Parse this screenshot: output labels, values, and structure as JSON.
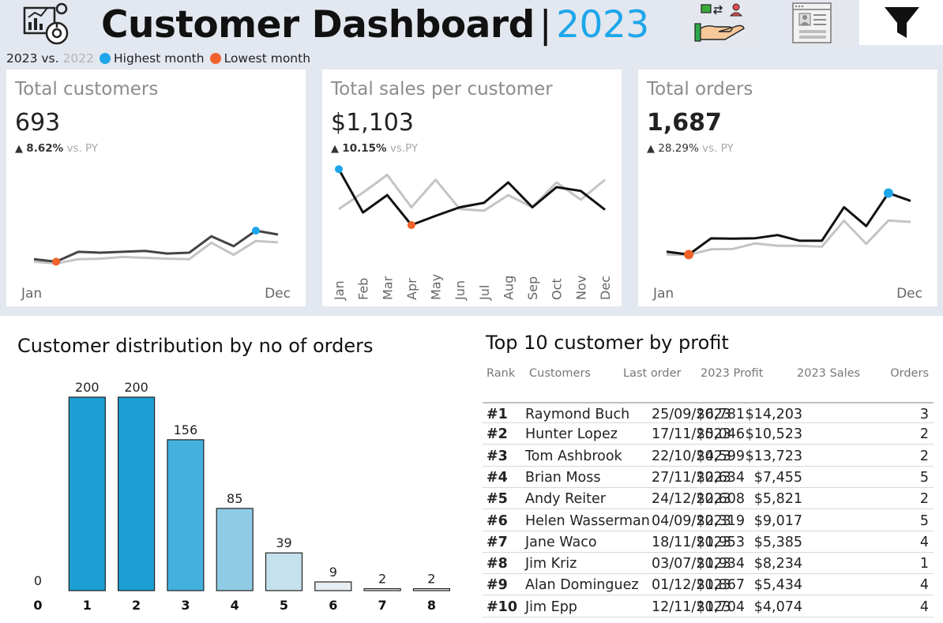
{
  "header": {
    "title": "Customer Dashboard",
    "separator": "|",
    "year": "2023",
    "icons": [
      "dashboard-analytics-icon",
      "customer-exchange-icon",
      "document-view-icon",
      "filter-icon"
    ]
  },
  "legend": {
    "current_year": "2023 vs.",
    "prior_year": "2022",
    "highest_label": "Highest month",
    "lowest_label": "Lowest month",
    "highest_color": "#1ea6ea",
    "lowest_color": "#f0622a"
  },
  "kpis": [
    {
      "label": "Total customers",
      "value": "693",
      "change": "8.62%",
      "vs": "vs. PY",
      "x_start": "Jan",
      "x_end": "Dec"
    },
    {
      "label": "Total sales per customer",
      "value": "$1,103",
      "change": "10.15%",
      "vs": "vs.PY"
    },
    {
      "label": "Total orders",
      "value": "1,687",
      "change": "28.29%",
      "vs": "vs. PY",
      "x_start": "Jan",
      "x_end": "Dec"
    }
  ],
  "chart_data": [
    {
      "type": "line",
      "title": "Total customers",
      "x": [
        "Jan",
        "Feb",
        "Mar",
        "Apr",
        "May",
        "Jun",
        "Jul",
        "Aug",
        "Sep",
        "Oct",
        "Nov",
        "Dec"
      ],
      "series": [
        {
          "name": "2023",
          "values": [
            40,
            34,
            57,
            55,
            57,
            59,
            53,
            55,
            93,
            70,
            106,
            97
          ]
        },
        {
          "name": "2022",
          "values": [
            34,
            30,
            40,
            41,
            45,
            43,
            41,
            40,
            78,
            50,
            82,
            79
          ]
        }
      ],
      "highest_index": 10,
      "lowest_index": 1,
      "ylim": [
        0,
        260
      ]
    },
    {
      "type": "line",
      "title": "Total sales per customer",
      "x": [
        "Jan",
        "Feb",
        "Mar",
        "Apr",
        "May",
        "Jun",
        "Jul",
        "Aug",
        "Sep",
        "Oct",
        "Nov",
        "Dec"
      ],
      "series": [
        {
          "name": "2023",
          "values": [
            1583,
            1134,
            1314,
            1003,
            1098,
            1188,
            1234,
            1446,
            1188,
            1397,
            1357,
            1162
          ]
        },
        {
          "name": "2022",
          "values": [
            1170,
            1340,
            1524,
            1188,
            1474,
            1170,
            1152,
            1314,
            1188,
            1446,
            1266,
            1474
          ]
        }
      ],
      "highest_index": 0,
      "lowest_index": 3,
      "ylim": [
        700,
        1700
      ]
    },
    {
      "type": "line",
      "title": "Total orders",
      "x": [
        "Jan",
        "Feb",
        "Mar",
        "Apr",
        "May",
        "Jun",
        "Jul",
        "Aug",
        "Sep",
        "Oct",
        "Nov",
        "Dec"
      ],
      "series": [
        {
          "name": "2023",
          "values": [
            54,
            35,
            143,
            141,
            144,
            165,
            127,
            127,
            351,
            225,
            445,
            393
          ]
        },
        {
          "name": "2022",
          "values": [
            35,
            33,
            70,
            73,
            110,
            94,
            94,
            88,
            261,
            106,
            262,
            253
          ]
        }
      ],
      "highest_index": 10,
      "lowest_index": 1,
      "ylim": [
        -110,
        700
      ]
    },
    {
      "type": "bar",
      "title": "Customer distribution by no of orders",
      "categories": [
        "0",
        "1",
        "2",
        "3",
        "4",
        "5",
        "6",
        "7",
        "8"
      ],
      "values": [
        0,
        200,
        200,
        156,
        85,
        39,
        9,
        2,
        2
      ],
      "ylim": [
        0,
        200
      ]
    }
  ],
  "table": {
    "title": "Top 10 customer by profit",
    "columns": [
      "Rank",
      "Customers",
      "Last order",
      "2023 Profit",
      "2023 Sales",
      "Orders"
    ],
    "rows": [
      {
        "rank": "#1",
        "name": "Raymond Buch",
        "last_order": "25/09/2023",
        "profit": "$6,781",
        "sales": "$14,203",
        "orders": "3"
      },
      {
        "rank": "#2",
        "name": "Hunter Lopez",
        "last_order": "17/11/2023",
        "profit": "$5,046",
        "sales": "$10,523",
        "orders": "2"
      },
      {
        "rank": "#3",
        "name": "Tom Ashbrook",
        "last_order": "22/10/2023",
        "profit": "$4,599",
        "sales": "$13,723",
        "orders": "2"
      },
      {
        "rank": "#4",
        "name": "Brian Moss",
        "last_order": "27/11/2023",
        "profit": "$2,634",
        "sales": "$7,455",
        "orders": "5"
      },
      {
        "rank": "#5",
        "name": "Andy Reiter",
        "last_order": "24/12/2023",
        "profit": "$2,608",
        "sales": "$5,821",
        "orders": "2"
      },
      {
        "rank": "#6",
        "name": "Helen Wasserman",
        "last_order": "04/09/2023",
        "profit": "$2,319",
        "sales": "$9,017",
        "orders": "5"
      },
      {
        "rank": "#7",
        "name": "Jane Waco",
        "last_order": "18/11/2023",
        "profit": "$1,953",
        "sales": "$5,385",
        "orders": "4"
      },
      {
        "rank": "#8",
        "name": "Jim Kriz",
        "last_order": "03/07/2023",
        "profit": "$1,934",
        "sales": "$8,234",
        "orders": "1"
      },
      {
        "rank": "#9",
        "name": "Alan Dominguez",
        "last_order": "01/12/2023",
        "profit": "$1,867",
        "sales": "$5,434",
        "orders": "4"
      },
      {
        "rank": "#10",
        "name": "Jim Epp",
        "last_order": "12/11/2023",
        "profit": "$1,704",
        "sales": "$4,074",
        "orders": "4"
      }
    ]
  },
  "colors": {
    "current_line": "#333333",
    "prior_line": "#c4c4c4",
    "bar_palette": [
      "#1c9fd3",
      "#1c9fd3",
      "#1c9fd3",
      "#43b0dd",
      "#8fcbe4",
      "#c4e1ed",
      "#e6eef3",
      "#f0f3f6",
      "#f0f3f6"
    ]
  }
}
